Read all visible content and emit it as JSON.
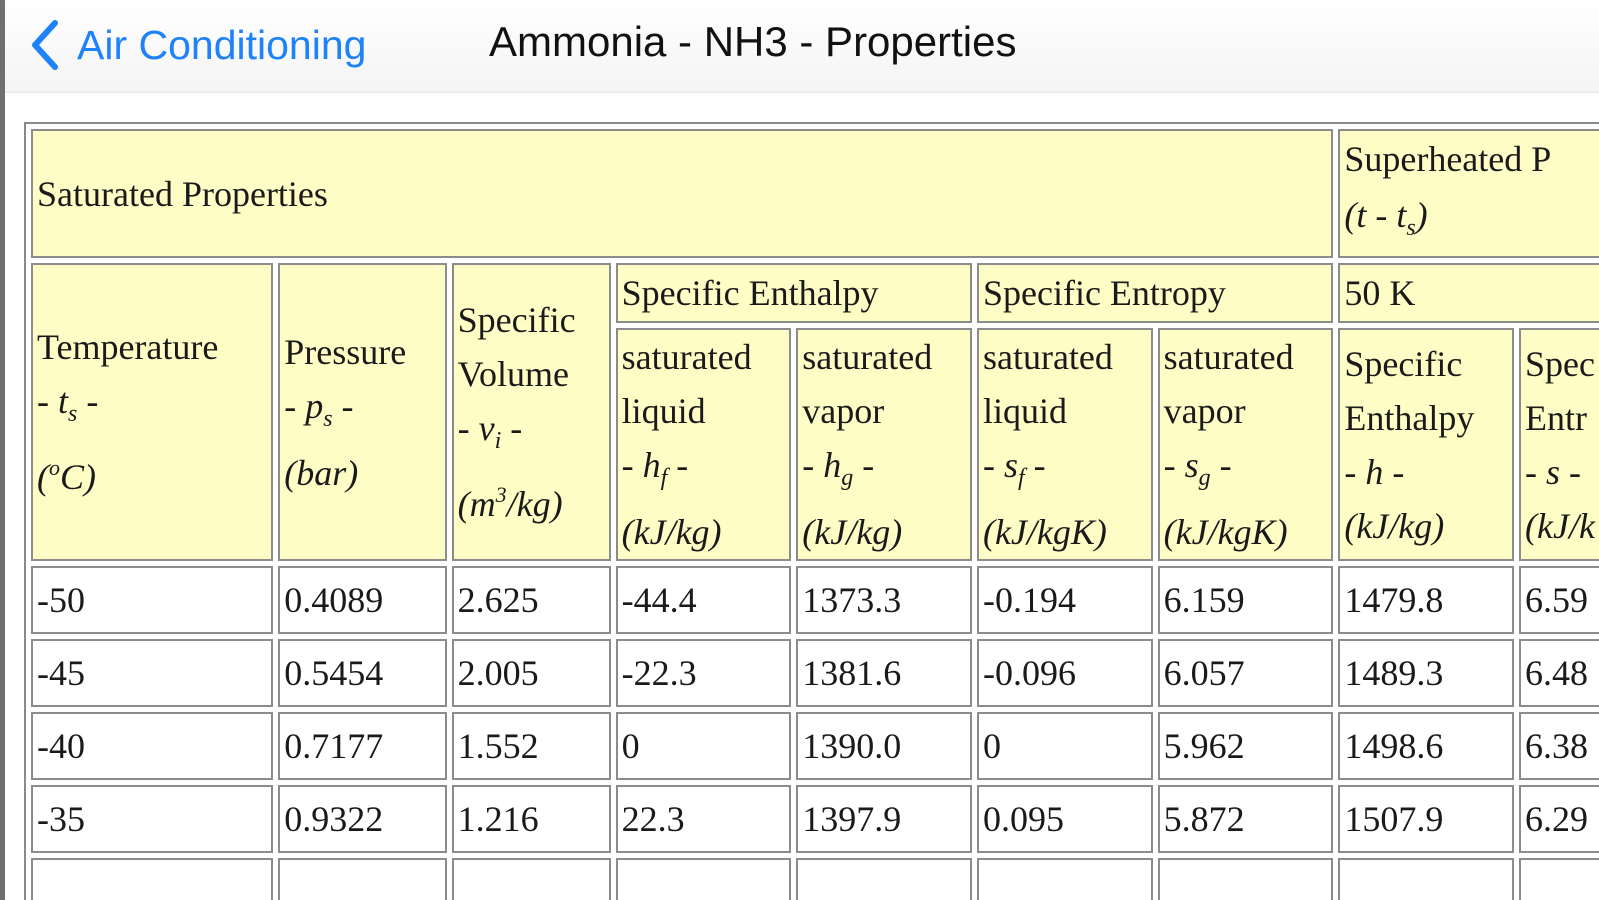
{
  "navbar": {
    "back_label": "Air Conditioning",
    "title": "Ammonia - NH3 - Properties",
    "accent": "#1e82fa",
    "back_icon": "chevron-left-icon"
  },
  "table": {
    "header_bg": "#fdfdc5",
    "saturated_title": "Saturated Properties",
    "superheated_title": "Superheated P",
    "superheated_sub": {
      "pre": "(t - t",
      "sub": "s",
      "post": ")"
    },
    "groups": {
      "enthalpy": "Specific Enthalpy",
      "entropy": "Specific Entropy",
      "superheat": "50 K"
    },
    "columns": [
      {
        "l1": "Temperature",
        "l2": "",
        "sym": "- t",
        "sub": "s",
        "sym_post": " -",
        "unit": "(",
        "unit_sup": "o",
        "unit_post": "C)"
      },
      {
        "l1": "Pressure",
        "l2": "",
        "sym": "- p",
        "sub": "s",
        "sym_post": " -",
        "unit": "(bar)",
        "unit_sup": "",
        "unit_post": ""
      },
      {
        "l1": "Specific",
        "l2": "Volume",
        "sym": "- v",
        "sub": "i",
        "sym_post": " -",
        "unit": "(m",
        "unit_sup": "3",
        "unit_post": "/kg)"
      },
      {
        "l1": "saturated",
        "l2": "liquid",
        "sym": "- h",
        "sub": "f",
        "sym_post": " -",
        "unit": "(kJ/kg)",
        "unit_sup": "",
        "unit_post": ""
      },
      {
        "l1": "saturated",
        "l2": "vapor",
        "sym": "- h",
        "sub": "g",
        "sym_post": " -",
        "unit": "(kJ/kg)",
        "unit_sup": "",
        "unit_post": ""
      },
      {
        "l1": "saturated",
        "l2": "liquid",
        "sym": "- s",
        "sub": "f",
        "sym_post": " -",
        "unit": "(kJ/kgK)",
        "unit_sup": "",
        "unit_post": ""
      },
      {
        "l1": "saturated",
        "l2": "vapor",
        "sym": "- s",
        "sub": "g",
        "sym_post": " -",
        "unit": "(kJ/kgK)",
        "unit_sup": "",
        "unit_post": ""
      },
      {
        "l1": "Specific",
        "l2": "Enthalpy",
        "sym": "- h -",
        "sub": "",
        "sym_post": "",
        "unit": "(kJ/kg)",
        "unit_sup": "",
        "unit_post": ""
      },
      {
        "l1": "Spec",
        "l2": "Entr",
        "sym": "- s -",
        "sub": "",
        "sym_post": "",
        "unit": "(kJ/k",
        "unit_sup": "",
        "unit_post": ""
      }
    ],
    "rows": [
      [
        "-50",
        "0.4089",
        "2.625",
        "-44.4",
        "1373.3",
        "-0.194",
        "6.159",
        "1479.8",
        "6.59"
      ],
      [
        "-45",
        "0.5454",
        "2.005",
        "-22.3",
        "1381.6",
        "-0.096",
        "6.057",
        "1489.3",
        "6.48"
      ],
      [
        "-40",
        "0.7177",
        "1.552",
        "0",
        "1390.0",
        "0",
        "5.962",
        "1498.6",
        "6.38"
      ],
      [
        "-35",
        "0.9322",
        "1.216",
        "22.3",
        "1397.9",
        "0.095",
        "5.872",
        "1507.9",
        "6.29"
      ],
      [
        "",
        "",
        "",
        "",
        "",
        "",
        "",
        "",
        ""
      ]
    ]
  }
}
